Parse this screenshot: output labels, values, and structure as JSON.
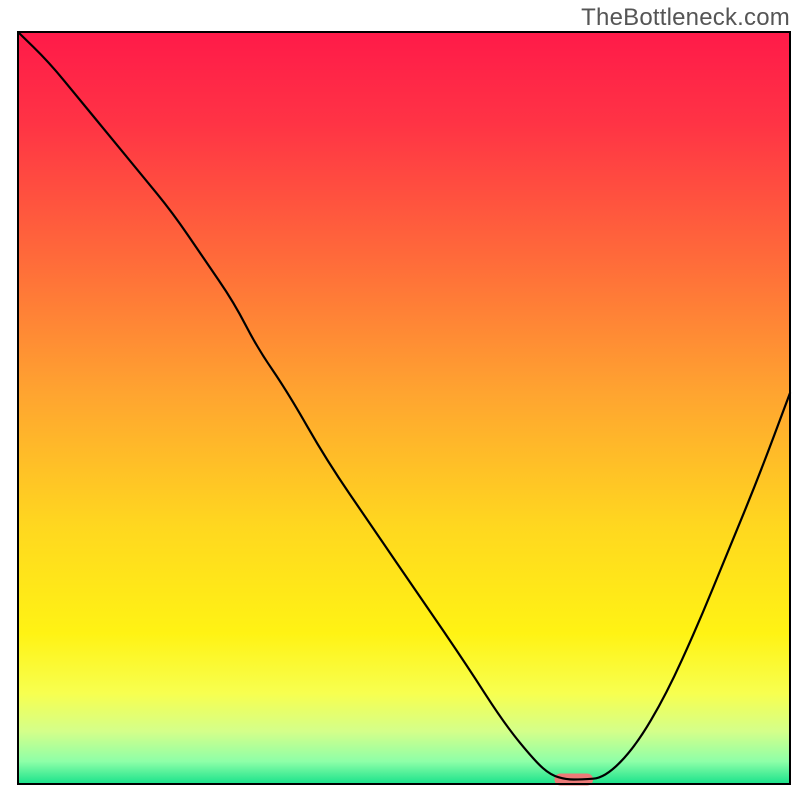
{
  "watermark": "TheBottleneck.com",
  "chart_data": {
    "type": "line",
    "title": "",
    "xlabel": "",
    "ylabel": "",
    "xlim": [
      0,
      100
    ],
    "ylim": [
      0,
      100
    ],
    "grid": false,
    "legend": false,
    "background_gradient_stops": [
      {
        "offset": 0.0,
        "color": "#ff1a49"
      },
      {
        "offset": 0.12,
        "color": "#ff3345"
      },
      {
        "offset": 0.3,
        "color": "#ff6a3a"
      },
      {
        "offset": 0.48,
        "color": "#ffa430"
      },
      {
        "offset": 0.66,
        "color": "#ffd81f"
      },
      {
        "offset": 0.8,
        "color": "#fff314"
      },
      {
        "offset": 0.88,
        "color": "#f7ff50"
      },
      {
        "offset": 0.93,
        "color": "#d4ff8a"
      },
      {
        "offset": 0.97,
        "color": "#8effa8"
      },
      {
        "offset": 1.0,
        "color": "#19e28b"
      }
    ],
    "series": [
      {
        "name": "bottleneck-curve",
        "color": "#000000",
        "stroke_width": 2.2,
        "x": [
          0,
          4,
          8,
          12,
          16,
          20,
          24,
          28,
          31,
          35,
          40,
          46,
          52,
          58,
          63,
          67,
          69,
          71,
          73,
          76,
          80,
          84,
          88,
          92,
          96,
          100
        ],
        "y": [
          100,
          96,
          91,
          86,
          81,
          76,
          70,
          64,
          58,
          52,
          43,
          34,
          25,
          16,
          8,
          3,
          1.2,
          0.6,
          0.6,
          0.8,
          5,
          12,
          21,
          31,
          41,
          52
        ]
      }
    ],
    "annotations": [
      {
        "name": "optimal-marker",
        "shape": "rounded-rect",
        "x_center": 72,
        "y_center": 0.6,
        "width": 5,
        "height": 1.6,
        "fill": "#ed7a78",
        "rx": 1
      }
    ]
  }
}
